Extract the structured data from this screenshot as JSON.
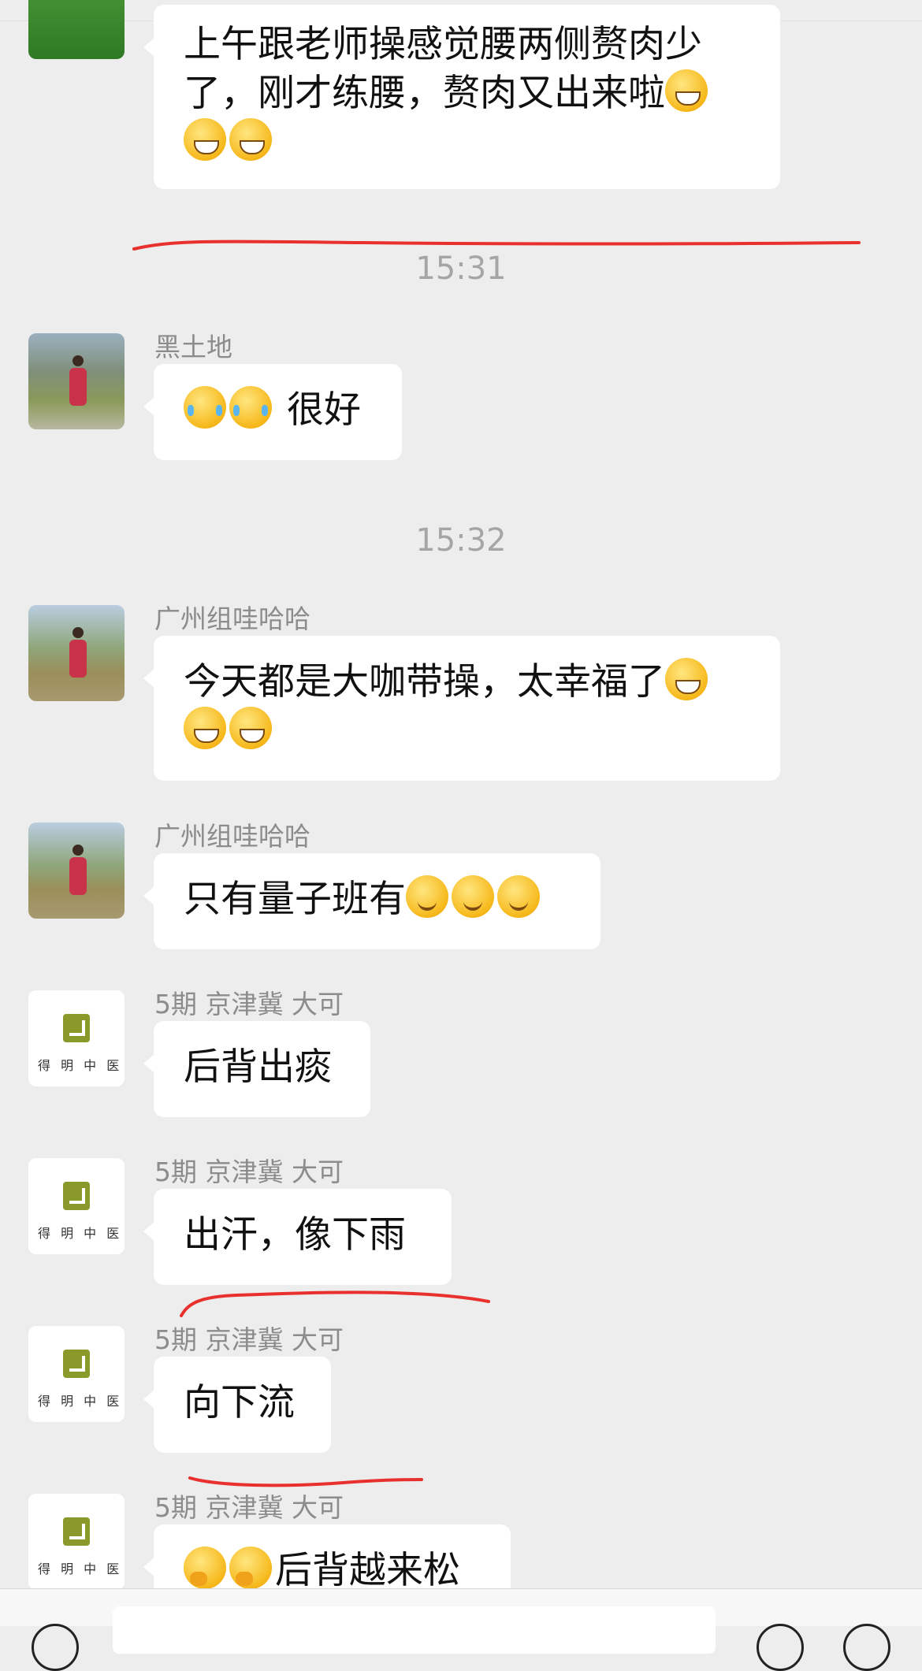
{
  "messages": {
    "m0": {
      "text": "上午跟老师操感觉腰两侧赘肉少了，刚才练腰，赘肉又出来啦",
      "emoji": [
        "laugh-cry-emoji",
        "laugh-cry-emoji",
        "laugh-cry-emoji"
      ]
    },
    "t1": "15:31",
    "m1": {
      "sender": "黑土地",
      "text": "很好",
      "emoji": [
        "tears-emoji",
        "tears-emoji"
      ]
    },
    "t2": "15:32",
    "m2": {
      "sender": "广州组哇哈哈",
      "text": "今天都是大咖带操，太幸福了",
      "emoji": [
        "grin-emoji",
        "grin-emoji",
        "grin-emoji"
      ]
    },
    "m3": {
      "sender": "广州组哇哈哈",
      "text": "只有量子班有",
      "emoji": [
        "smirk-emoji",
        "smirk-emoji",
        "smirk-emoji"
      ]
    },
    "m4": {
      "sender": "5期 京津冀 大可",
      "text": "后背出痰"
    },
    "m5": {
      "sender": "5期 京津冀 大可",
      "text": "出汗，像下雨"
    },
    "m6": {
      "sender": "5期 京津冀 大可",
      "text": "向下流"
    },
    "m7": {
      "sender": "5期 京津冀 大可",
      "text": "后背越来松",
      "emoji": [
        "thinking-emoji",
        "thinking-emoji"
      ]
    }
  },
  "logo": {
    "text": "得 明 中 医"
  },
  "colors": {
    "background": "#ededed",
    "bubble": "#ffffff",
    "annotation": "#e8302e",
    "timestamp": "#a5a5a5",
    "sender": "#8c8c8c"
  }
}
